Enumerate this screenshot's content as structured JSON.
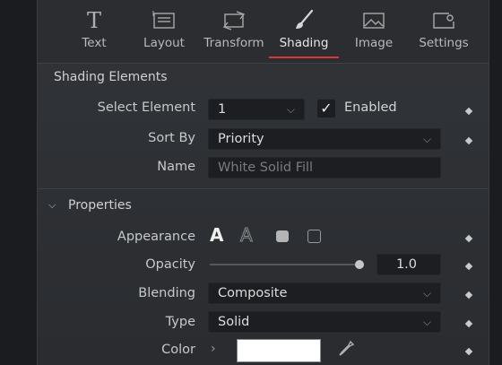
{
  "tabs": [
    {
      "label": "Text",
      "icon": "text-tool-icon",
      "active": false
    },
    {
      "label": "Layout",
      "icon": "layout-icon",
      "active": false
    },
    {
      "label": "Transform",
      "icon": "transform-icon",
      "active": false
    },
    {
      "label": "Shading",
      "icon": "brush-icon",
      "active": true
    },
    {
      "label": "Image",
      "icon": "image-icon",
      "active": false
    },
    {
      "label": "Settings",
      "icon": "settings-icon",
      "active": false
    }
  ],
  "shading": {
    "title": "Shading Elements",
    "select_element_label": "Select Element",
    "select_element_value": "1",
    "enabled_label": "Enabled",
    "enabled_checked": true,
    "sort_by_label": "Sort By",
    "sort_by_value": "Priority",
    "name_label": "Name",
    "name_placeholder": "White Solid Fill"
  },
  "properties": {
    "title": "Properties",
    "appearance_label": "Appearance",
    "appearance_options": [
      "A",
      "A",
      "■",
      "□"
    ],
    "opacity_label": "Opacity",
    "opacity_value": "1.0",
    "opacity_fraction": 1.0,
    "blending_label": "Blending",
    "blending_value": "Composite",
    "type_label": "Type",
    "type_value": "Solid",
    "color_label": "Color",
    "color_value": "#ffffff"
  },
  "colors": {
    "accent_underline": "#d9383a",
    "panel_bg": "#2f3135",
    "field_bg": "#1d1e21"
  }
}
